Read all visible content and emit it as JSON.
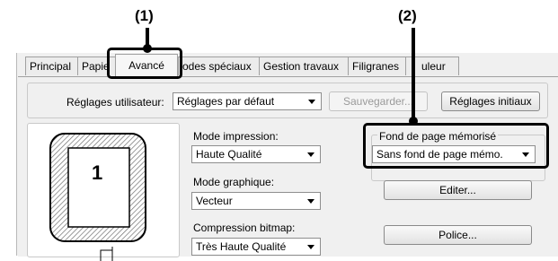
{
  "callouts": {
    "one": "(1)",
    "two": "(2)"
  },
  "tabs": [
    {
      "label": "Principal"
    },
    {
      "label": "Papie"
    },
    {
      "label": "Avancé"
    },
    {
      "label": "odes spéciaux"
    },
    {
      "label": "Gestion travaux"
    },
    {
      "label": "Filigranes"
    },
    {
      "label": "uleur"
    }
  ],
  "user_settings": {
    "label": "Réglages utilisateur:",
    "value": "Réglages par défaut",
    "save_button": "Sauvegarder...",
    "initial_button": "Réglages initiaux"
  },
  "preview": {
    "page_number": "1"
  },
  "print_mode": {
    "label": "Mode impression:",
    "value": "Haute Qualité"
  },
  "graphics_mode": {
    "label": "Mode graphique:",
    "value": "Vecteur"
  },
  "bitmap_compression": {
    "label": "Compression bitmap:",
    "value": "Très Haute Qualité"
  },
  "overlay": {
    "label": "Fond de page mémorisé",
    "value": "Sans fond de page mémo.",
    "edit_button": "Editer..."
  },
  "font_button": "Police..."
}
